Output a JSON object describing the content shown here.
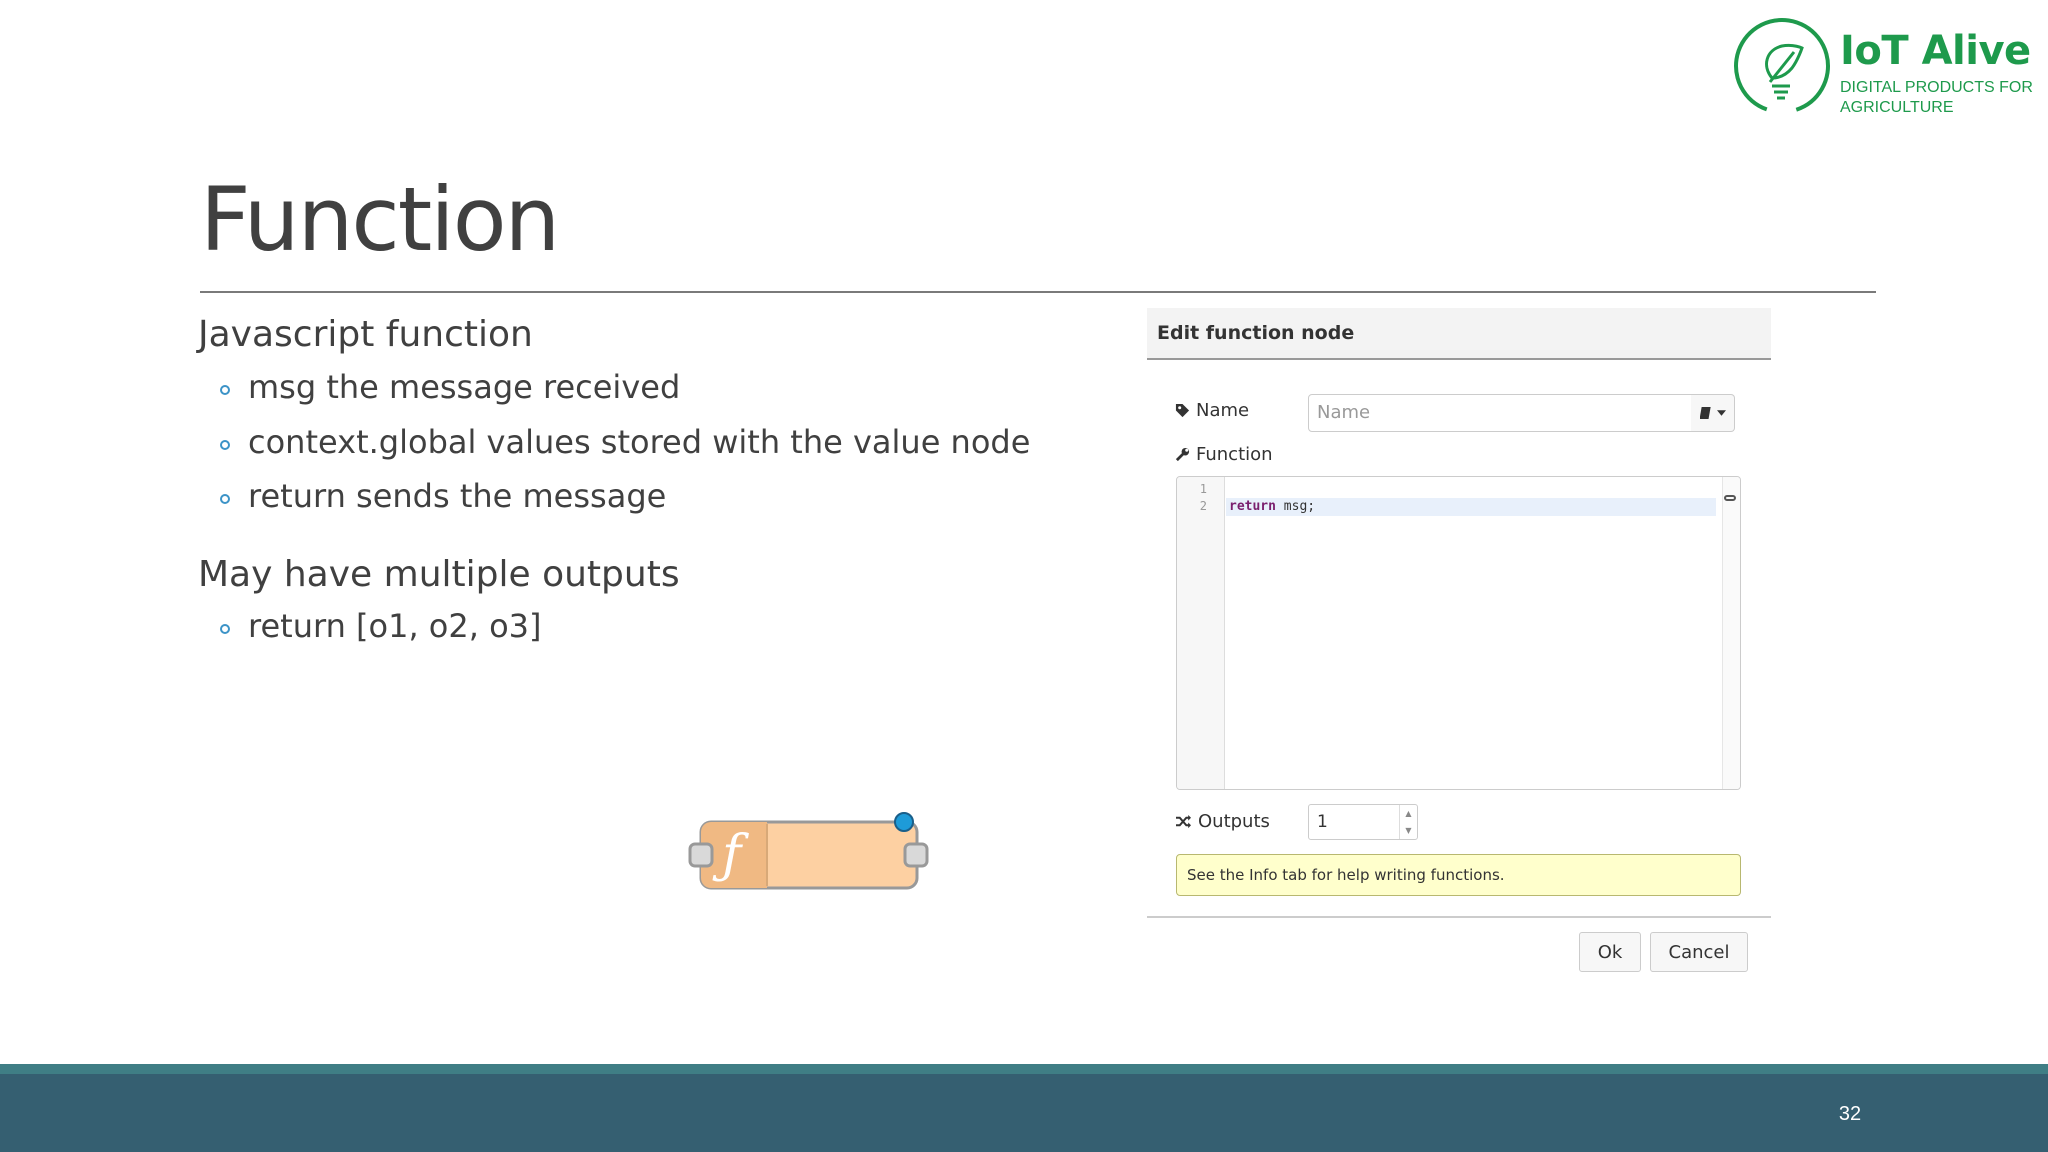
{
  "logo": {
    "title": "IoT Alive",
    "subtitle": "DIGITAL PRODUCTS FOR AGRICULTURE",
    "color": "#1e9a4c"
  },
  "slide": {
    "title": "Function",
    "page_number": "32"
  },
  "bullets": {
    "heading1": "Javascript function",
    "items1": [
      "msg the message received",
      "context.global values stored with the value node",
      "return sends the message"
    ],
    "heading2": "May have multiple outputs",
    "items2": [
      "return [o1, o2, o3]"
    ]
  },
  "node": {
    "icon_label": "ƒ",
    "color": "#fdd0a2"
  },
  "dialog": {
    "title": "Edit function node",
    "name_label": "Name",
    "name_placeholder": "Name",
    "function_label": "Function",
    "line_numbers": [
      "1",
      "2"
    ],
    "code_keyword": "return",
    "code_rest": " msg;",
    "outputs_label": "Outputs",
    "outputs_value": "1",
    "tip": "See the Info tab for help writing functions.",
    "ok_label": "Ok",
    "cancel_label": "Cancel"
  },
  "colors": {
    "band": "#355f71",
    "band_accent": "#3f7e85",
    "bullet": "#3c93c7"
  }
}
